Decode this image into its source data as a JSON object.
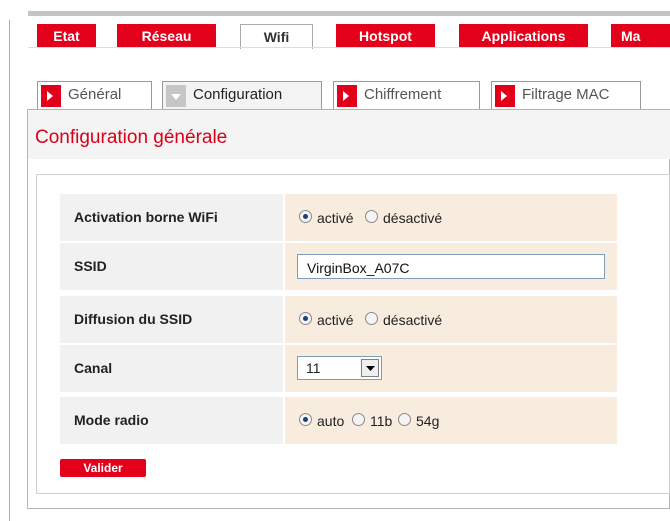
{
  "topnav": {
    "tabs": [
      {
        "label": "Etat",
        "active": false
      },
      {
        "label": "Réseau",
        "active": false
      },
      {
        "label": "Wifi",
        "active": true
      },
      {
        "label": "Hotspot",
        "active": false
      },
      {
        "label": "Applications",
        "active": false
      },
      {
        "label": "Ma",
        "active": false
      }
    ]
  },
  "subtabs": [
    {
      "label": "Général",
      "active": false
    },
    {
      "label": "Configuration",
      "active": true
    },
    {
      "label": "Chiffrement",
      "active": false
    },
    {
      "label": "Filtrage MAC",
      "active": false
    }
  ],
  "section_title": "Configuration générale",
  "form": {
    "activation": {
      "label": "Activation borne WiFi",
      "options": [
        "activé",
        "désactivé"
      ],
      "selected": "activé"
    },
    "ssid": {
      "label": "SSID",
      "value": "VirginBox_A07C"
    },
    "diffusion": {
      "label": "Diffusion du SSID",
      "options": [
        "activé",
        "désactivé"
      ],
      "selected": "activé"
    },
    "canal": {
      "label": "Canal",
      "value": "11"
    },
    "mode": {
      "label": "Mode radio",
      "options": [
        "auto",
        "11b",
        "54g"
      ],
      "selected": "auto"
    }
  },
  "submit_label": "Valider",
  "colors": {
    "accent": "#e2001a",
    "value_bg": "#f8ecdf",
    "label_bg": "#f1f1f1"
  }
}
